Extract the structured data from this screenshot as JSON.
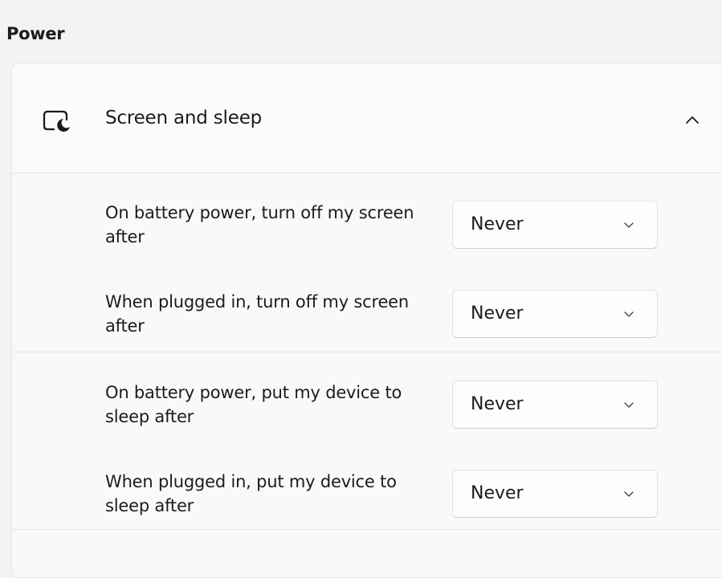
{
  "section": {
    "title": "Power"
  },
  "screen_and_sleep": {
    "title": "Screen and sleep",
    "icon": "screen-sleep-icon",
    "collapse_icon": "chevron-up-icon",
    "groups": [
      {
        "rows": [
          {
            "label": "On battery power, turn off my screen after",
            "value": "Never"
          },
          {
            "label": "When plugged in, turn off my screen after",
            "value": "Never"
          }
        ]
      },
      {
        "rows": [
          {
            "label": "On battery power, put my device to sleep after",
            "value": "Never"
          },
          {
            "label": "When plugged in, put my device to sleep after",
            "value": "Never"
          }
        ]
      }
    ]
  }
}
